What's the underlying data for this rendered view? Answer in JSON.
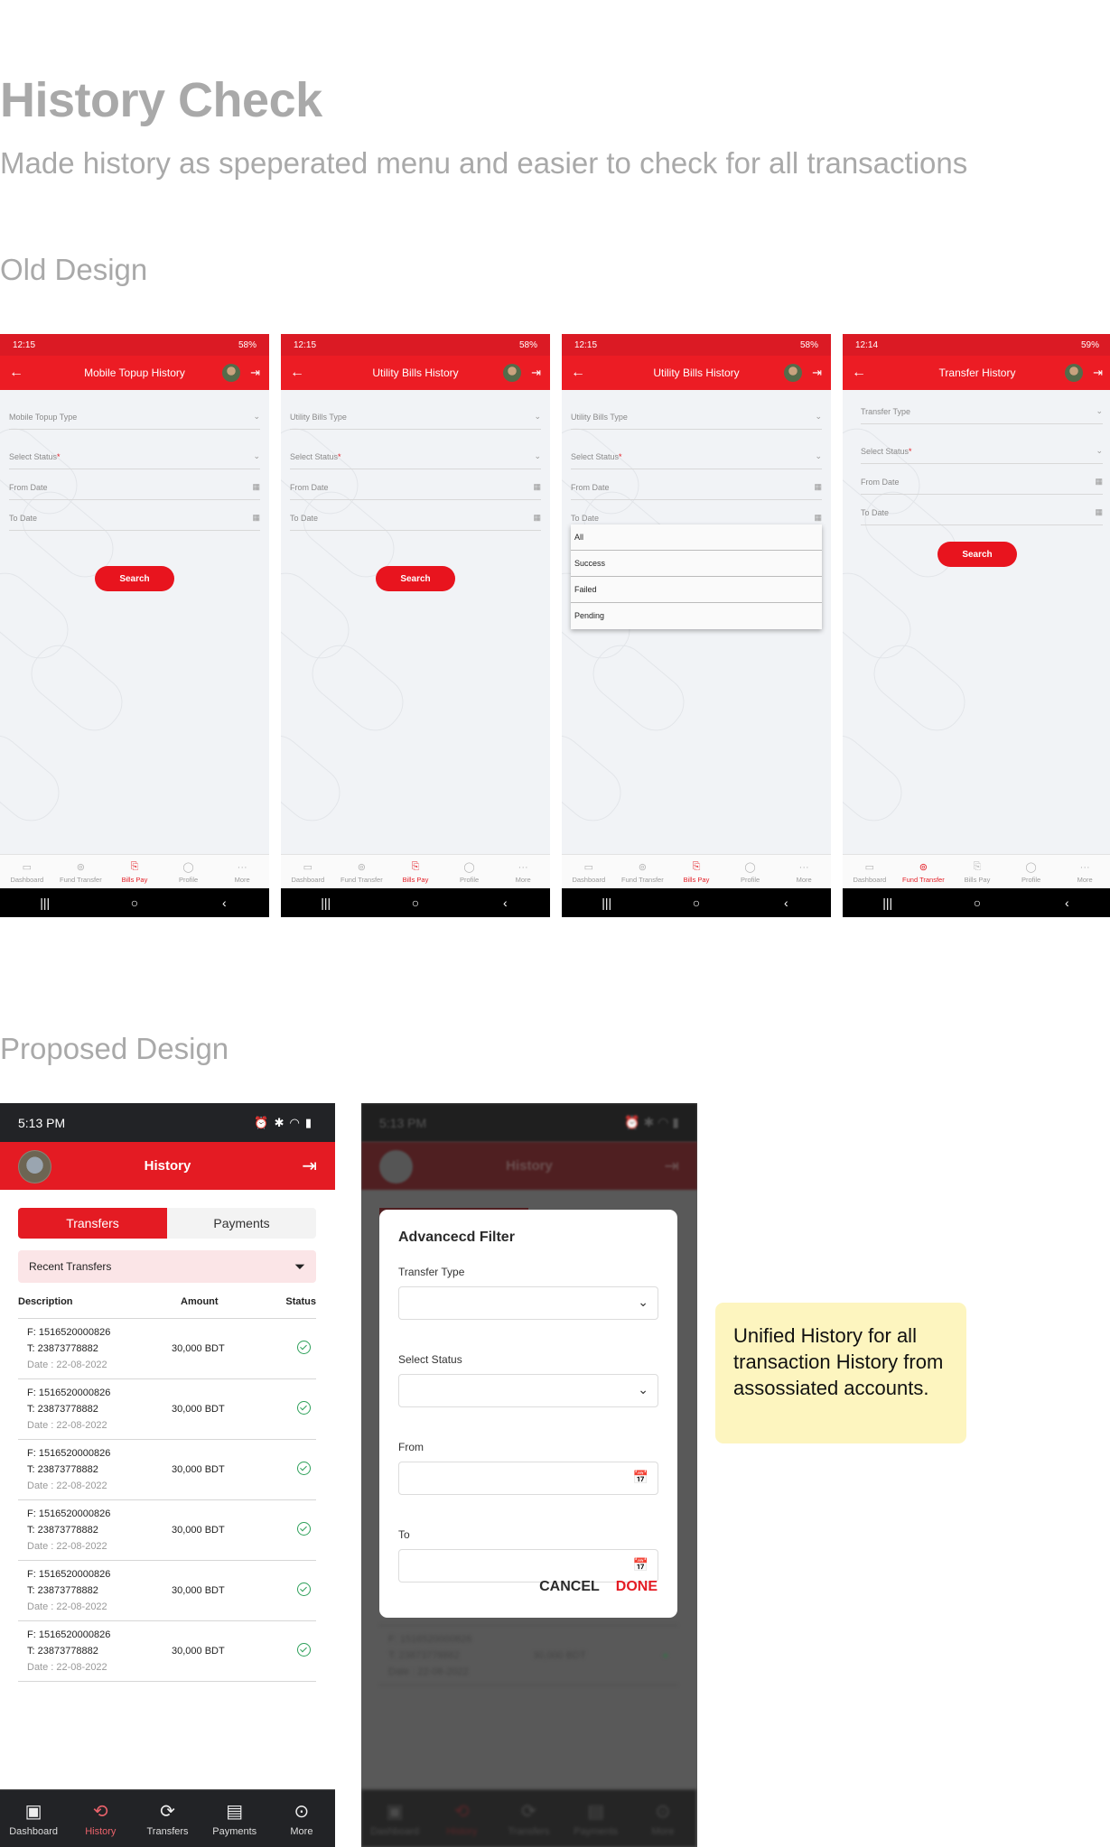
{
  "header": {
    "title": "History Check",
    "subtitle": "Made history as speperated menu and easier to check for all transactions",
    "old_section": "Old Design",
    "new_section": "Proposed Design"
  },
  "colors": {
    "brand_red": "#e41b23",
    "success_green": "#2ea05a",
    "note_yellow": "#fdf5bf"
  },
  "old_screens": [
    {
      "time": "12:15",
      "battery": "58%",
      "title": "Mobile Topup History",
      "fields": [
        "Mobile Topup Type",
        "Select Status",
        "From Date",
        "To Date"
      ],
      "search": "Search",
      "active_nav": "Bills Pay"
    },
    {
      "time": "12:15",
      "battery": "58%",
      "title": "Utility Bills History",
      "fields": [
        "Utility Bills Type",
        "Select Status",
        "From Date",
        "To Date"
      ],
      "search": "Search",
      "active_nav": "Bills Pay"
    },
    {
      "time": "12:15",
      "battery": "58%",
      "title": "Utility Bills History",
      "fields": [
        "Utility Bills Type",
        "Select Status",
        "From Date",
        "To Date"
      ],
      "search": "Search",
      "active_nav": "Bills Pay",
      "dropdown_options": [
        "All",
        "Success",
        "Failed",
        "Pending"
      ]
    },
    {
      "time": "12:14",
      "battery": "59%",
      "title": "Transfer History",
      "fields": [
        "Transfer Type",
        "Select Status",
        "From Date",
        "To Date"
      ],
      "search": "Search",
      "active_nav": "Fund Transfer"
    }
  ],
  "old_nav": [
    "Dashboard",
    "Fund Transfer",
    "Bills Pay",
    "Profile",
    "More"
  ],
  "required_mark": "*",
  "new_screen": {
    "time": "5:13 PM",
    "title": "History",
    "tabs": [
      "Transfers",
      "Payments"
    ],
    "active_tab": "Transfers",
    "recent_label": "Recent Transfers",
    "columns": [
      "Description",
      "Amount",
      "Status"
    ],
    "rows": [
      {
        "from": "F: 1516520000826",
        "to": "T: 23873778882",
        "date": "Date : 22-08-2022",
        "amount": "30,000 BDT",
        "status": "success"
      },
      {
        "from": "F: 1516520000826",
        "to": "T: 23873778882",
        "date": "Date : 22-08-2022",
        "amount": "30,000 BDT",
        "status": "success"
      },
      {
        "from": "F: 1516520000826",
        "to": "T: 23873778882",
        "date": "Date : 22-08-2022",
        "amount": "30,000 BDT",
        "status": "success"
      },
      {
        "from": "F: 1516520000826",
        "to": "T: 23873778882",
        "date": "Date : 22-08-2022",
        "amount": "30,000 BDT",
        "status": "success"
      },
      {
        "from": "F: 1516520000826",
        "to": "T: 23873778882",
        "date": "Date : 22-08-2022",
        "amount": "30,000 BDT",
        "status": "success"
      },
      {
        "from": "F: 1516520000826",
        "to": "T: 23873778882",
        "date": "Date : 22-08-2022",
        "amount": "30,000 BDT",
        "status": "success"
      }
    ],
    "nav": [
      "Dashboard",
      "History",
      "Transfers",
      "Payments",
      "More"
    ],
    "active_nav": "History"
  },
  "filter_modal": {
    "title": "Advancecd Filter",
    "fields": [
      {
        "label": "Transfer Type",
        "type": "select",
        "value": ""
      },
      {
        "label": "Select Status",
        "type": "select",
        "value": ""
      },
      {
        "label": "From",
        "type": "date",
        "value": ""
      },
      {
        "label": "To",
        "type": "date",
        "value": ""
      }
    ],
    "cancel": "CANCEL",
    "done": "DONE"
  },
  "note": "Unified History for all transaction History from assossiated accounts."
}
